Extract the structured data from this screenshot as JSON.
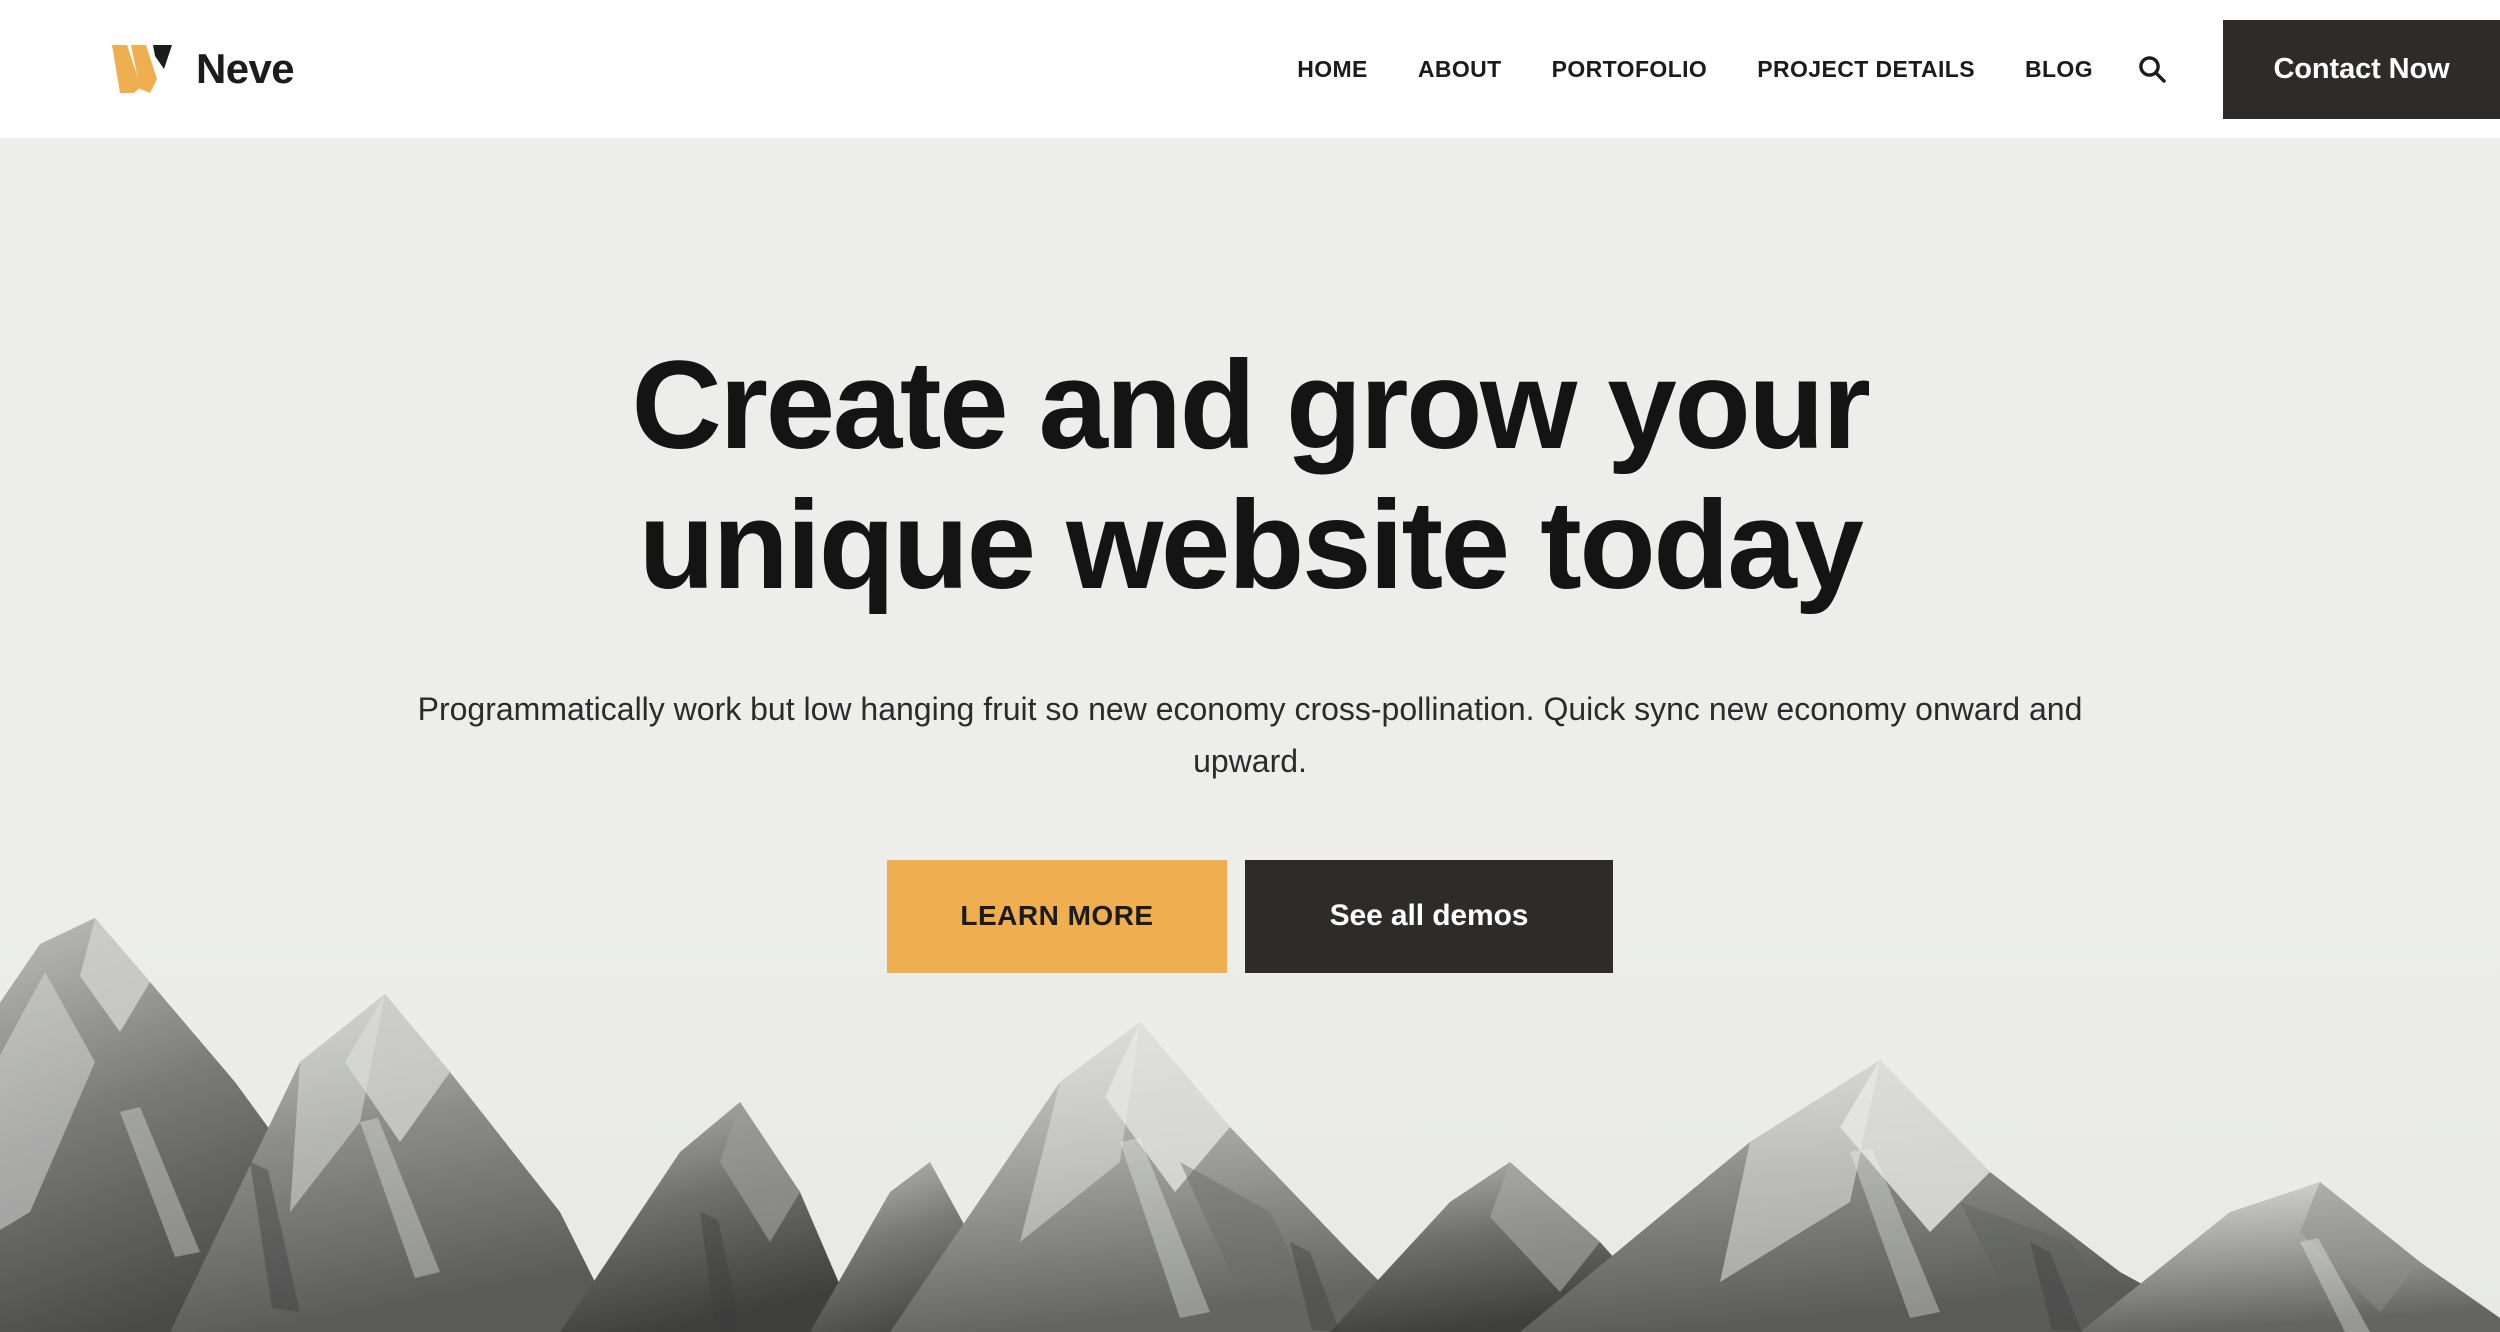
{
  "brand": {
    "name": "Neve",
    "logo_icon": "neve-w-logo-icon",
    "logo_colors": {
      "amber": "#EFAF51",
      "dark": "#1C1C1C"
    }
  },
  "header": {
    "background": "#FFFFFF",
    "nav_items": [
      {
        "label": "HOME",
        "name": "home"
      },
      {
        "label": "ABOUT",
        "name": "about"
      },
      {
        "label": "PORTOFOLIO",
        "name": "portofolio"
      },
      {
        "label": "PROJECT DETAILS",
        "name": "project-details"
      },
      {
        "label": "BLOG",
        "name": "blog"
      }
    ],
    "search_icon": "search-icon",
    "contact_button": {
      "label": "Contact Now",
      "background": "#2E2C2B",
      "text_color": "#FFFFFF"
    }
  },
  "hero": {
    "background": "#EDEEEC",
    "title_line1": "Create and grow your",
    "title_line2": "unique website today",
    "subtitle": "Programmatically work but low hanging fruit so new economy cross-pollination. Quick sync new economy onward and upward.",
    "primary_button": {
      "label": "LEARN MORE",
      "background": "#EFAF51",
      "text_color": "#1B1B1B"
    },
    "secondary_button": {
      "label": "See all demos",
      "background": "#2E2C2B",
      "text_color": "#FFFFFF"
    },
    "background_image": "grayscale-mountain-range-photo"
  }
}
